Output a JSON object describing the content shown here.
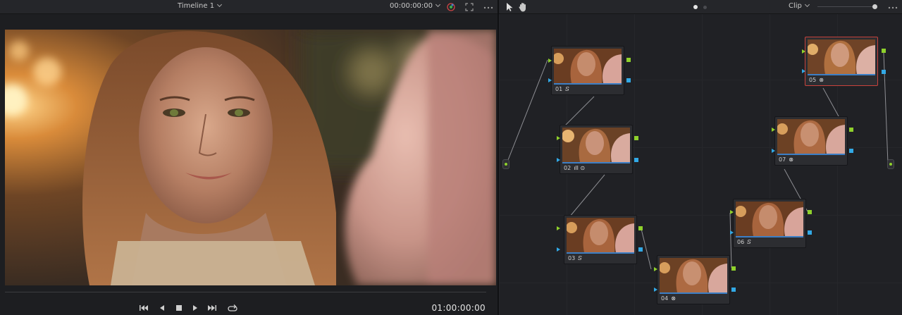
{
  "viewer": {
    "timeline_title": "Timeline 1",
    "top_timecode": "00:00:00:00",
    "timecode": "01:00:00:00",
    "transport": [
      "skip-back-icon",
      "step-back-icon",
      "stop-icon",
      "play-icon",
      "skip-forward-icon",
      "loop-icon"
    ]
  },
  "node_editor": {
    "mode_label": "Clip",
    "nodes": [
      {
        "id": "01",
        "icon": "curve-icon",
        "glyph": "𝑆"
      },
      {
        "id": "02",
        "icon": "bars-clock-icon",
        "glyph": "ıll ⊙"
      },
      {
        "id": "03",
        "icon": "curve-icon",
        "glyph": "𝑆"
      },
      {
        "id": "04",
        "icon": "cross-circle-icon",
        "glyph": "⊗"
      },
      {
        "id": "05",
        "icon": "cross-circle-icon",
        "glyph": "⊗"
      },
      {
        "id": "06",
        "icon": "curve-icon",
        "glyph": "𝑆"
      },
      {
        "id": "07",
        "icon": "cross-circle-icon",
        "glyph": "⊗"
      }
    ]
  },
  "colors": {
    "accent_green": "#8fd12c",
    "accent_blue": "#32a9e6",
    "selected_red": "#c9423c"
  }
}
